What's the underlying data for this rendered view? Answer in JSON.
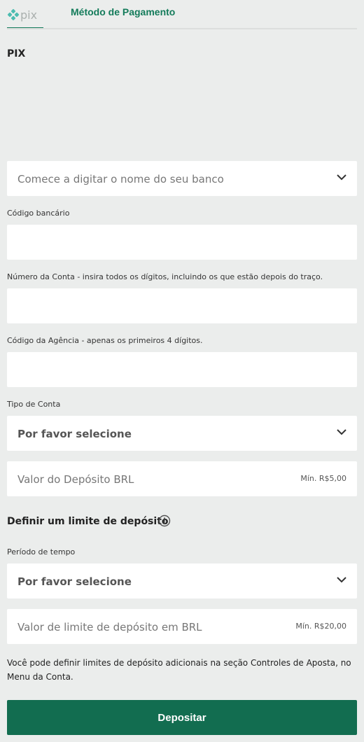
{
  "header": {
    "logo_text": "pix",
    "method_title": "Método de Pagamento"
  },
  "section_title": "PIX",
  "bank_select": {
    "placeholder": "Comece a digitar o nome do seu banco"
  },
  "bank_code": {
    "label": "Código bancário",
    "value": ""
  },
  "account_number": {
    "label": "Número da Conta - insira todos os dígitos, incluindo os que estão depois do traço.",
    "value": ""
  },
  "agency_code": {
    "label": "Código da Agência - apenas os primeiros 4 dígitos.",
    "value": ""
  },
  "account_type": {
    "label": "Tipo de Conta",
    "placeholder": "Por favor selecione"
  },
  "deposit_amount": {
    "placeholder": "Valor do Depósito BRL",
    "hint": "Mín. R$5,00"
  },
  "limit": {
    "title": "Definir um limite de depósito",
    "period_label": "Período de tempo",
    "period_placeholder": "Por favor selecione",
    "amount_placeholder": "Valor de limite de depósito em BRL",
    "amount_hint": "Mín. R$20,00"
  },
  "note": "Você pode definir limites de depósito adicionais na seção Controles de Aposta, no Menu da Conta.",
  "deposit_button": "Depositar",
  "colors": {
    "brand_green": "#137b5a",
    "button_green": "#126d50",
    "background": "#ebedec"
  }
}
